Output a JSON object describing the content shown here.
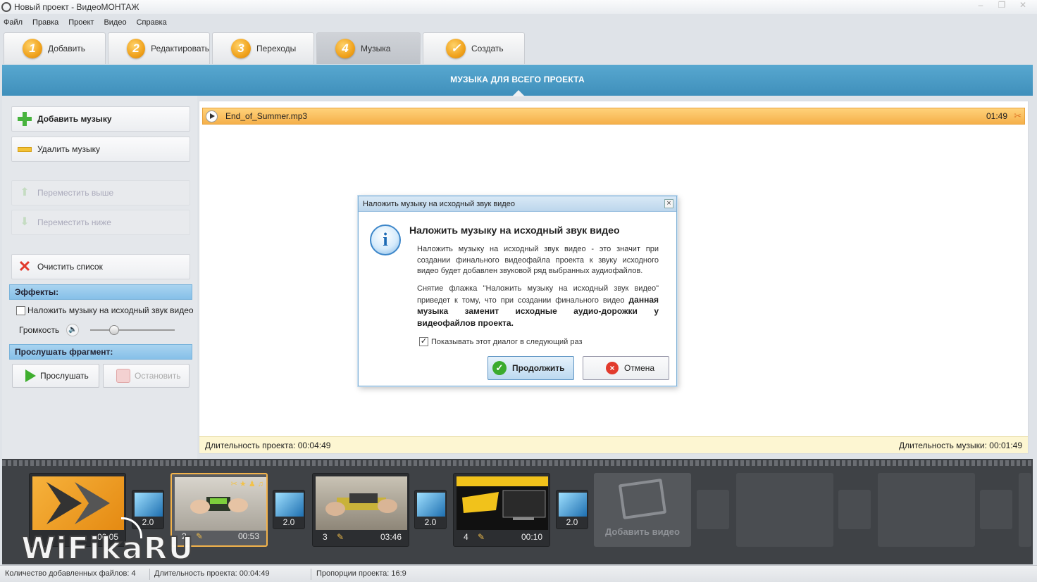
{
  "window": {
    "title": "Новый проект - ВидеоМОНТАЖ"
  },
  "menu": [
    "Файл",
    "Правка",
    "Проект",
    "Видео",
    "Справка"
  ],
  "steps": [
    {
      "num": "1",
      "label": "Добавить"
    },
    {
      "num": "2",
      "label": "Редактировать"
    },
    {
      "num": "3",
      "label": "Переходы"
    },
    {
      "num": "4",
      "label": "Музыка",
      "active": true
    },
    {
      "num": "✓",
      "label": "Создать"
    }
  ],
  "section_title": "МУЗЫКА ДЛЯ ВСЕГО ПРОЕКТА",
  "left": {
    "add_music": "Добавить музыку",
    "remove_music": "Удалить музыку",
    "move_up": "Переместить выше",
    "move_down": "Переместить ниже",
    "clear_list": "Очистить список",
    "effects_header": "Эффекты:",
    "overlay_checkbox": "Наложить музыку на исходный звук видео",
    "volume_label": "Громкость",
    "volume_level": 0.25,
    "listen_header": "Прослушать фрагмент:",
    "listen": "Прослушать",
    "stop": "Остановить"
  },
  "track": {
    "filename": "End_of_Summer.mp3",
    "duration": "01:49"
  },
  "info": {
    "project_duration": "Длительность проекта: 00:04:49",
    "music_duration": "Длительность музыки: 00:01:49"
  },
  "dialog": {
    "title": "Наложить музыку на исходный звук видео",
    "heading": "Наложить музыку на исходный звук видео",
    "para1": "Наложить музыку на исходный звук видео - это значит при создании финального видеофайла проекта к звуку исходного видео будет добавлен звуковой ряд выбранных аудиофайлов.",
    "para2_normal": "Снятие флажка \"Наложить музыку на исходный звук видео\" приведет к тому, что при создании финального видео",
    "para2_bold": "данная музыка заменит исходные аудио-дорожки у видеофайлов проекта.",
    "show_again": "Показывать этот диалог в следующий раз",
    "continue": "Продолжить",
    "cancel": "Отмена"
  },
  "timeline": {
    "clips": [
      {
        "num": "",
        "time": "00:05"
      },
      {
        "num": "2",
        "time": "00:53"
      },
      {
        "num": "3",
        "time": "03:46"
      },
      {
        "num": "4",
        "time": "00:10"
      }
    ],
    "transitions": [
      "2.0",
      "2.0",
      "2.0",
      "2.0"
    ],
    "add_video": "Добавить видео"
  },
  "watermark": "WiFikaRU",
  "status": {
    "files": "Количество добавленных файлов: 4",
    "duration": "Длительность проекта:  00:04:49",
    "aspect": "Пропорции проекта:  16:9"
  }
}
